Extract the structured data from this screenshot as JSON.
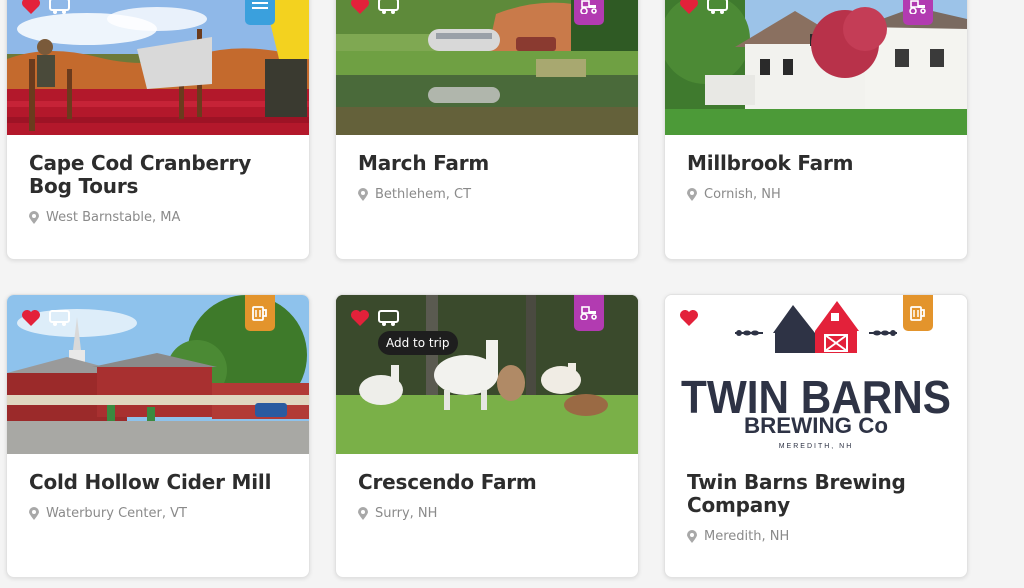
{
  "colors": {
    "heart": "#e3213a",
    "badge_purple": "#b23bb1",
    "badge_orange": "#e3942c",
    "badge_blue": "#3aa0dd",
    "title_text": "#2d2d2d",
    "location_text": "#8a8a8a"
  },
  "cards": [
    {
      "title": "Cape Cod Cranberry Bog Tours",
      "location": "West Barnstable, MA",
      "category_icon": "menu-icon"
    },
    {
      "title": "March Farm",
      "location": "Bethlehem, CT",
      "category_icon": "tractor-icon"
    },
    {
      "title": "Millbrook Farm",
      "location": "Cornish, NH",
      "category_icon": "tractor-icon"
    },
    {
      "title": "Cold Hollow Cider Mill",
      "location": "Waterbury Center, VT",
      "category_icon": "beer-mug-icon"
    },
    {
      "title": "Crescendo Farm",
      "location": "Surry, NH",
      "category_icon": "tractor-icon",
      "tooltip": "Add to trip"
    },
    {
      "title": "Twin Barns Brewing Company",
      "location": "Meredith, NH",
      "category_icon": "beer-mug-icon",
      "logo": {
        "line1": "TWIN BARNS",
        "line2": "BREWING Co",
        "line3": "MEREDITH, NH"
      }
    }
  ]
}
